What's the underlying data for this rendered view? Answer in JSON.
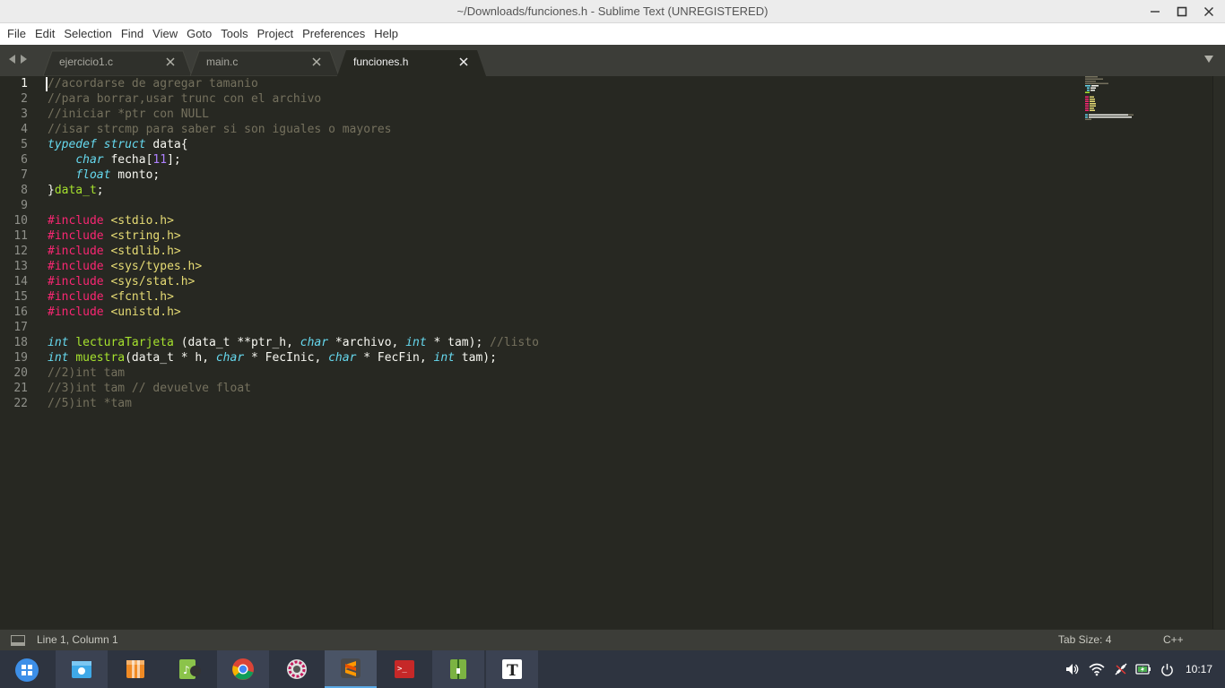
{
  "window": {
    "title": "~/Downloads/funciones.h - Sublime Text (UNREGISTERED)"
  },
  "menu": [
    "File",
    "Edit",
    "Selection",
    "Find",
    "View",
    "Goto",
    "Tools",
    "Project",
    "Preferences",
    "Help"
  ],
  "tabs": [
    {
      "label": "ejercicio1.c",
      "active": false
    },
    {
      "label": "main.c",
      "active": false
    },
    {
      "label": "funciones.h",
      "active": true
    }
  ],
  "editor": {
    "current_line": 1,
    "lines": [
      [
        [
          "c",
          "//acordarse de agregar tamanio"
        ]
      ],
      [
        [
          "c",
          "//para borrar,usar trunc con el archivo"
        ]
      ],
      [
        [
          "c",
          "//iniciar *ptr con NULL"
        ]
      ],
      [
        [
          "c",
          "//isar strcmp para saber si son iguales o mayores"
        ]
      ],
      [
        [
          "k",
          "typedef"
        ],
        [
          "t",
          " "
        ],
        [
          "k",
          "struct"
        ],
        [
          "t",
          " data{"
        ]
      ],
      [
        [
          "t",
          "    "
        ],
        [
          "k",
          "char"
        ],
        [
          "t",
          " fecha["
        ],
        [
          "n",
          "11"
        ],
        [
          "t",
          "];"
        ]
      ],
      [
        [
          "t",
          "    "
        ],
        [
          "k",
          "float"
        ],
        [
          "t",
          " monto;"
        ]
      ],
      [
        [
          "t",
          "}"
        ],
        [
          "y",
          "data_t"
        ],
        [
          "t",
          ";"
        ]
      ],
      [],
      [
        [
          "p",
          "#include"
        ],
        [
          "t",
          " "
        ],
        [
          "s",
          "<stdio.h>"
        ]
      ],
      [
        [
          "p",
          "#include"
        ],
        [
          "t",
          " "
        ],
        [
          "s",
          "<string.h>"
        ]
      ],
      [
        [
          "p",
          "#include"
        ],
        [
          "t",
          " "
        ],
        [
          "s",
          "<stdlib.h>"
        ]
      ],
      [
        [
          "p",
          "#include"
        ],
        [
          "t",
          " "
        ],
        [
          "s",
          "<sys/types.h>"
        ]
      ],
      [
        [
          "p",
          "#include"
        ],
        [
          "t",
          " "
        ],
        [
          "s",
          "<sys/stat.h>"
        ]
      ],
      [
        [
          "p",
          "#include"
        ],
        [
          "t",
          " "
        ],
        [
          "s",
          "<fcntl.h>"
        ]
      ],
      [
        [
          "p",
          "#include"
        ],
        [
          "t",
          " "
        ],
        [
          "s",
          "<unistd.h>"
        ]
      ],
      [],
      [
        [
          "k",
          "int"
        ],
        [
          "t",
          " "
        ],
        [
          "f",
          "lecturaTarjeta"
        ],
        [
          "t",
          " (data_t **ptr_h, "
        ],
        [
          "k",
          "char"
        ],
        [
          "t",
          " *archivo, "
        ],
        [
          "k",
          "int"
        ],
        [
          "t",
          " * tam); "
        ],
        [
          "c",
          "//listo"
        ]
      ],
      [
        [
          "k",
          "int"
        ],
        [
          "t",
          " "
        ],
        [
          "f",
          "muestra"
        ],
        [
          "t",
          "(data_t * h, "
        ],
        [
          "k",
          "char"
        ],
        [
          "t",
          " * FecInic, "
        ],
        [
          "k",
          "char"
        ],
        [
          "t",
          " * FecFin, "
        ],
        [
          "k",
          "int"
        ],
        [
          "t",
          " tam);"
        ]
      ],
      [
        [
          "c",
          "//2)int tam"
        ]
      ],
      [
        [
          "c",
          "//3)int tam // devuelve float"
        ]
      ],
      [
        [
          "c",
          "//5)int *tam"
        ]
      ]
    ]
  },
  "status": {
    "position": "Line 1, Column 1",
    "tab_size": "Tab Size: 4",
    "syntax": "C++"
  },
  "taskbar": {
    "apps": [
      "file-manager-icon",
      "archive-manager-icon",
      "music-player-icon",
      "chrome-icon",
      "settings-icon",
      "sublime-text-icon",
      "terminal-icon",
      "archiver-icon",
      "typora-icon"
    ],
    "clock": "10:17"
  },
  "colors": {
    "editor_bg": "#272822",
    "comment": "#75715e",
    "keyword": "#66d9ef",
    "preprocessor": "#f92672",
    "string": "#e6db74",
    "number": "#ae81ff",
    "function": "#a6e22e",
    "taskbar_bg": "#2e3440"
  }
}
